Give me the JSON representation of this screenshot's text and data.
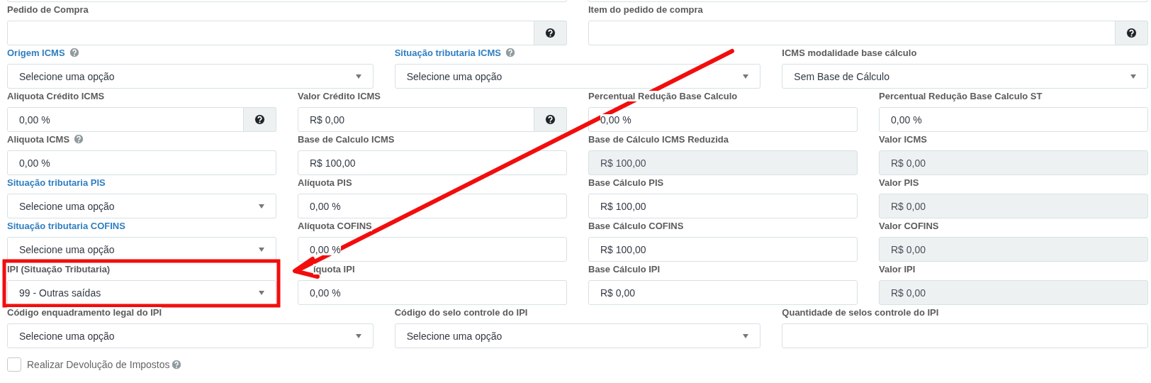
{
  "rows": [
    {
      "clipped_top": true,
      "fields": [
        {
          "kind": "input",
          "readonly": false,
          "addon": false
        },
        {
          "kind": "input",
          "readonly": false,
          "addon": false
        }
      ]
    },
    {
      "clipped_top": false,
      "fields": [
        {
          "kind": "input",
          "label": "Pedido de Compra",
          "link": false,
          "help": false,
          "readonly": false,
          "addon": true
        },
        {
          "kind": "input",
          "label": "Item do pedido de compra",
          "link": false,
          "help": false,
          "readonly": false,
          "addon": true
        }
      ]
    },
    {
      "clipped_top": false,
      "fields": [
        {
          "kind": "select",
          "label": "Origem ICMS",
          "link": true,
          "help": true,
          "value": "Selecione uma opção"
        },
        {
          "kind": "select",
          "label": "Situação tributaria ICMS",
          "link": true,
          "help": true,
          "value": "Selecione uma opção"
        },
        {
          "kind": "select",
          "label": "ICMS modalidade base cálculo",
          "link": false,
          "help": false,
          "value": "Sem Base de Cálculo"
        }
      ]
    },
    {
      "clipped_top": false,
      "fields": [
        {
          "kind": "input",
          "label": "Aliquota Crédito ICMS",
          "link": false,
          "help": false,
          "value": "0,00 %",
          "readonly": false,
          "addon": true
        },
        {
          "kind": "input",
          "label": "Valor Crédito ICMS",
          "link": false,
          "help": false,
          "value": "R$ 0,00",
          "readonly": false,
          "addon": true
        },
        {
          "kind": "input",
          "label": "Percentual Redução Base Calculo",
          "link": false,
          "help": false,
          "value": "0,00 %",
          "readonly": false,
          "addon": false
        },
        {
          "kind": "input",
          "label": "Percentual Redução Base Calculo ST",
          "link": false,
          "help": false,
          "value": "0,00 %",
          "readonly": false,
          "addon": false
        }
      ]
    },
    {
      "clipped_top": false,
      "fields": [
        {
          "kind": "input",
          "label": "Aliquota ICMS",
          "link": false,
          "help": true,
          "value": "0,00 %",
          "readonly": false,
          "addon": false
        },
        {
          "kind": "input",
          "label": "Base de Calculo ICMS",
          "link": false,
          "help": false,
          "value": "R$ 100,00",
          "readonly": false,
          "addon": false
        },
        {
          "kind": "input",
          "label": "Base de Cálculo ICMS Reduzida",
          "link": false,
          "help": false,
          "value": "R$ 100,00",
          "readonly": true,
          "addon": false
        },
        {
          "kind": "input",
          "label": "Valor ICMS",
          "link": false,
          "help": false,
          "value": "R$ 0,00",
          "readonly": true,
          "addon": false
        }
      ]
    },
    {
      "clipped_top": false,
      "fields": [
        {
          "kind": "select",
          "label": "Situação tributaria PIS",
          "link": true,
          "help": false,
          "value": "Selecione uma opção"
        },
        {
          "kind": "input",
          "label": "Alíquota PIS",
          "link": false,
          "help": false,
          "value": "0,00 %",
          "readonly": false,
          "addon": false
        },
        {
          "kind": "input",
          "label": "Base Cálculo PIS",
          "link": false,
          "help": false,
          "value": "R$ 100,00",
          "readonly": false,
          "addon": false
        },
        {
          "kind": "input",
          "label": "Valor PIS",
          "link": false,
          "help": false,
          "value": "R$ 0,00",
          "readonly": true,
          "addon": false
        }
      ]
    },
    {
      "clipped_top": false,
      "fields": [
        {
          "kind": "select",
          "label": "Situação tributaria COFINS",
          "link": true,
          "help": false,
          "value": "Selecione uma opção"
        },
        {
          "kind": "input",
          "label": "Alíquota COFINS",
          "link": false,
          "help": false,
          "value": "0,00 %",
          "readonly": false,
          "addon": false
        },
        {
          "kind": "input",
          "label": "Base Cálculo COFINS",
          "link": false,
          "help": false,
          "value": "R$ 100,00",
          "readonly": false,
          "addon": false
        },
        {
          "kind": "input",
          "label": "Valor COFINS",
          "link": false,
          "help": false,
          "value": "R$ 0,00",
          "readonly": true,
          "addon": false
        }
      ]
    },
    {
      "clipped_top": false,
      "fields": [
        {
          "kind": "select",
          "label": "IPI (Situação Tributaria)",
          "link": false,
          "help": false,
          "value": "99 - Outras saídas"
        },
        {
          "kind": "input",
          "label": "íquota IPI",
          "link": false,
          "help": false,
          "value": "0,00 %",
          "readonly": false,
          "addon": false
        },
        {
          "kind": "input",
          "label": "Base Cálculo IPI",
          "link": false,
          "help": false,
          "value": "R$ 0,00",
          "readonly": false,
          "addon": false
        },
        {
          "kind": "input",
          "label": "Valor IPI",
          "link": false,
          "help": false,
          "value": "R$ 0,00",
          "readonly": true,
          "addon": false
        }
      ]
    },
    {
      "clipped_top": false,
      "fields": [
        {
          "kind": "select",
          "label": "Código enquadramento legal do IPI",
          "link": false,
          "help": false,
          "value": "Selecione uma opção"
        },
        {
          "kind": "select",
          "label": "Código do selo controle do IPI",
          "link": false,
          "help": false,
          "value": "Selecione uma opção"
        },
        {
          "kind": "input",
          "label": "Quantidade de selos controle do IPI",
          "link": false,
          "help": false,
          "readonly": false,
          "addon": false
        }
      ]
    }
  ],
  "checkbox": {
    "label": "Realizar Devolução de Impostos",
    "checked": false,
    "help": true
  },
  "annotations": {
    "highlight_box": true,
    "arrow": true
  }
}
